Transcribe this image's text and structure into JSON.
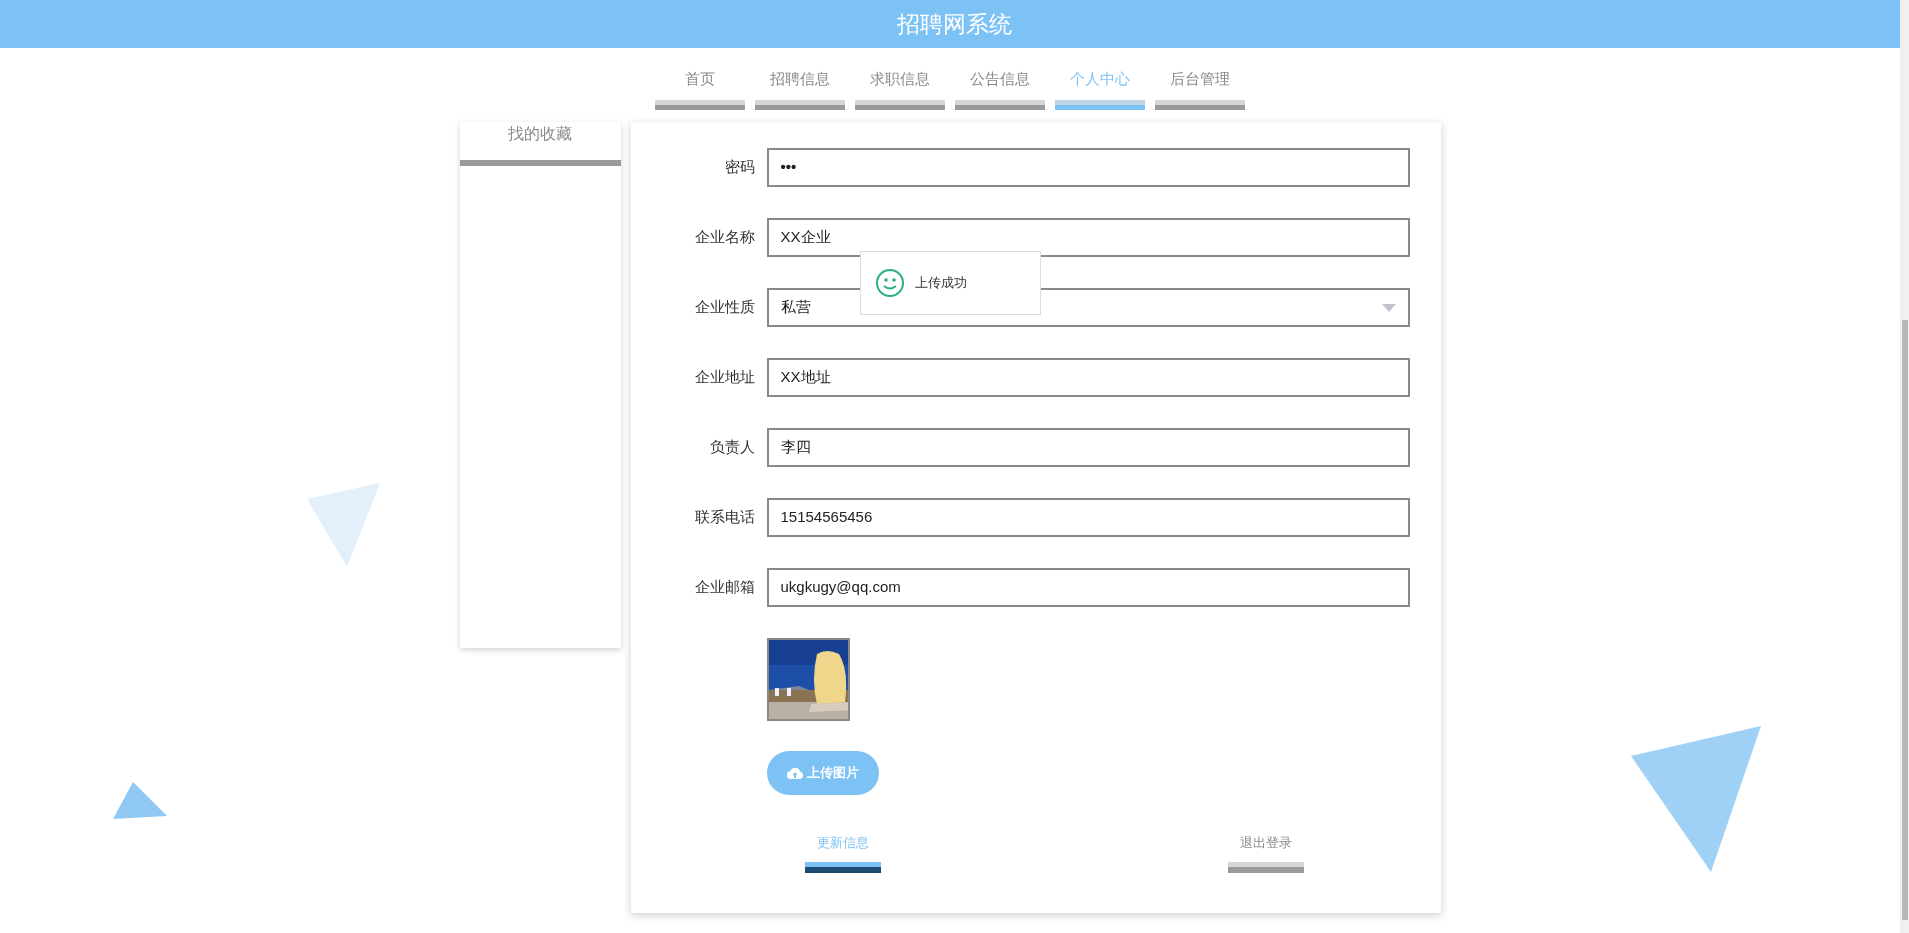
{
  "header": {
    "title": "招聘网系统"
  },
  "nav": {
    "tabs": [
      {
        "label": "首页",
        "selected": false
      },
      {
        "label": "招聘信息",
        "selected": false
      },
      {
        "label": "求职信息",
        "selected": false
      },
      {
        "label": "公告信息",
        "selected": false
      },
      {
        "label": "个人中心",
        "selected": true
      },
      {
        "label": "后台管理",
        "selected": false
      }
    ]
  },
  "sidebar": {
    "items": [
      {
        "label": "找的收藏"
      }
    ]
  },
  "form": {
    "fields": [
      {
        "label": "密码",
        "kind": "password",
        "value": "•••"
      },
      {
        "label": "企业名称",
        "kind": "text",
        "value": "XX企业"
      },
      {
        "label": "企业性质",
        "kind": "select",
        "value": "私营"
      },
      {
        "label": "企业地址",
        "kind": "text",
        "value": "XX地址"
      },
      {
        "label": "负责人",
        "kind": "text",
        "value": "李四"
      },
      {
        "label": "联系电话",
        "kind": "text",
        "value": "15154565456"
      },
      {
        "label": "企业邮箱",
        "kind": "text",
        "value": "ukgkugy@qq.com"
      }
    ],
    "upload_button": "上传图片",
    "actions": [
      {
        "label": "更新信息",
        "selected": true
      },
      {
        "label": "退出登录",
        "selected": false
      }
    ]
  },
  "toast": {
    "message": "上传成功"
  }
}
